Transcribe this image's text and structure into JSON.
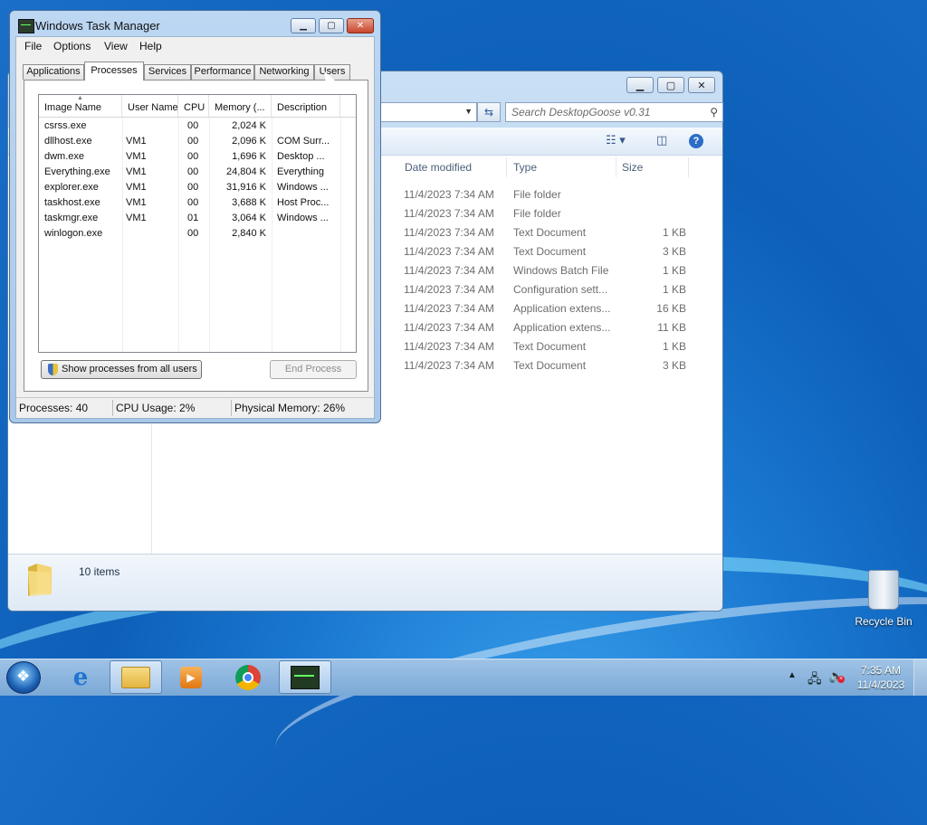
{
  "explorer": {
    "search_placeholder": "Search DesktopGoose v0.31",
    "columns": [
      "Date modified",
      "Type",
      "Size"
    ],
    "rows": [
      {
        "date": "11/4/2023 7:34 AM",
        "type": "File folder",
        "size": ""
      },
      {
        "date": "11/4/2023 7:34 AM",
        "type": "File folder",
        "size": ""
      },
      {
        "date": "11/4/2023 7:34 AM",
        "type": "Text Document",
        "size": "1 KB"
      },
      {
        "date": "11/4/2023 7:34 AM",
        "type": "Text Document",
        "size": "3 KB"
      },
      {
        "date": "11/4/2023 7:34 AM",
        "type": "Windows Batch File",
        "size": "1 KB"
      },
      {
        "date": "11/4/2023 7:34 AM",
        "type": "Configuration sett...",
        "size": "1 KB"
      },
      {
        "date": "11/4/2023 7:34 AM",
        "type": "Application extens...",
        "size": "16 KB"
      },
      {
        "date": "11/4/2023 7:34 AM",
        "type": "Application extens...",
        "size": "11 KB"
      },
      {
        "date": "11/4/2023 7:34 AM",
        "type": "Text Document",
        "size": "1 KB"
      },
      {
        "date": "11/4/2023 7:34 AM",
        "type": "Text Document",
        "size": "3 KB"
      }
    ],
    "items_count": "10 items"
  },
  "taskmgr": {
    "title": "Windows Task Manager",
    "menu": [
      "File",
      "Options",
      "View",
      "Help"
    ],
    "tabs": [
      "Applications",
      "Processes",
      "Services",
      "Performance",
      "Networking",
      "Users"
    ],
    "active_tab": "Processes",
    "columns": [
      "Image Name",
      "User Name",
      "CPU",
      "Memory (...",
      "Description"
    ],
    "processes": [
      {
        "name": "csrss.exe",
        "user": "",
        "cpu": "00",
        "mem": "2,024 K",
        "desc": ""
      },
      {
        "name": "dllhost.exe",
        "user": "VM1",
        "cpu": "00",
        "mem": "2,096 K",
        "desc": "COM Surr..."
      },
      {
        "name": "dwm.exe",
        "user": "VM1",
        "cpu": "00",
        "mem": "1,696 K",
        "desc": "Desktop ..."
      },
      {
        "name": "Everything.exe",
        "user": "VM1",
        "cpu": "00",
        "mem": "24,804 K",
        "desc": "Everything"
      },
      {
        "name": "explorer.exe",
        "user": "VM1",
        "cpu": "00",
        "mem": "31,916 K",
        "desc": "Windows ..."
      },
      {
        "name": "taskhost.exe",
        "user": "VM1",
        "cpu": "00",
        "mem": "3,688 K",
        "desc": "Host Proc..."
      },
      {
        "name": "taskmgr.exe",
        "user": "VM1",
        "cpu": "01",
        "mem": "3,064 K",
        "desc": "Windows ..."
      },
      {
        "name": "winlogon.exe",
        "user": "",
        "cpu": "00",
        "mem": "2,840 K",
        "desc": ""
      }
    ],
    "show_all_label": "Show processes from all users",
    "end_process_label": "End Process",
    "status": {
      "processes": "Processes: 40",
      "cpu": "CPU Usage: 2%",
      "memory": "Physical Memory: 26%"
    }
  },
  "desktop": {
    "recycle_bin": "Recycle Bin"
  },
  "taskbar": {
    "time": "7:35 AM",
    "date": "11/4/2023"
  },
  "icons": {
    "start": "windows-start-icon",
    "ie": "internet-explorer-icon",
    "explorer": "folder-icon",
    "media": "media-player-icon",
    "chrome": "chrome-icon",
    "taskmgr": "task-manager-icon"
  }
}
